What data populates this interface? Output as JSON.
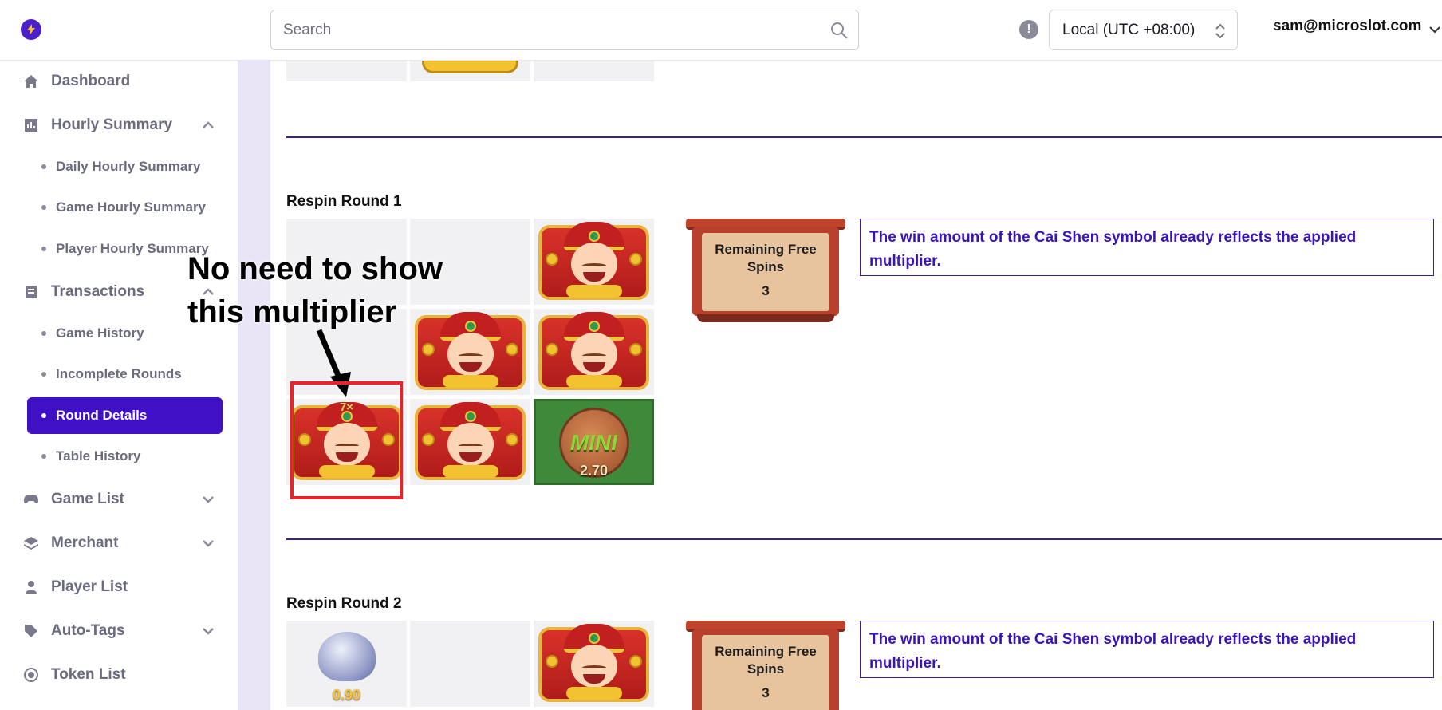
{
  "header": {
    "search_placeholder": "Search",
    "info_icon": "!",
    "timezone": "Local (UTC +08:00)",
    "user_email": "sam@microslot.com"
  },
  "sidebar": {
    "items": [
      {
        "label": "Dashboard"
      },
      {
        "label": "Hourly Summary"
      },
      {
        "label": "Daily Hourly Summary"
      },
      {
        "label": "Game Hourly Summary"
      },
      {
        "label": "Player Hourly Summary"
      },
      {
        "label": "Transactions"
      },
      {
        "label": "Game History"
      },
      {
        "label": "Incomplete Rounds"
      },
      {
        "label": "Round Details"
      },
      {
        "label": "Table History"
      },
      {
        "label": "Game List"
      },
      {
        "label": "Merchant"
      },
      {
        "label": "Player List"
      },
      {
        "label": "Auto-Tags"
      },
      {
        "label": "Token List"
      }
    ]
  },
  "rounds": [
    {
      "title": "Respin Round 1",
      "remaining_free_spins_label": "Remaining Free Spins",
      "remaining_free_spins": "3",
      "note": "The win amount of the Cai Shen symbol already reflects the applied multiplier.",
      "multiplier": "7×",
      "mini_label": "MINI",
      "mini_value": "2.70"
    },
    {
      "title": "Respin Round 2",
      "remaining_free_spins_label": "Remaining Free Spins",
      "remaining_free_spins": "3",
      "note": "The win amount of the Cai Shen symbol already reflects the applied multiplier.",
      "ingot_value": "0.90"
    }
  ],
  "annotation": {
    "line1": "No need to show",
    "line2": "this multiplier"
  },
  "colors": {
    "accent": "#3f10c4",
    "note_text": "#3a14b8",
    "annotation_box": "#e8232a"
  }
}
